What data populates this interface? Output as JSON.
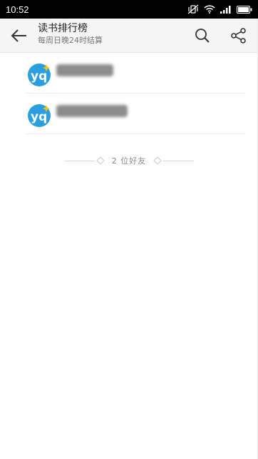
{
  "status_bar": {
    "time": "10:52",
    "icons": [
      "vibrate-off-icon",
      "wifi-icon",
      "signal-icon",
      "battery-icon"
    ]
  },
  "header": {
    "title": "读书排行榜",
    "subtitle": "每周日晚24时结算",
    "back_icon": "back-arrow-icon",
    "search_icon": "search-icon",
    "share_icon": "share-icon"
  },
  "friends": [
    {
      "avatar_icon": "yq-logo-avatar",
      "name": ""
    },
    {
      "avatar_icon": "yq-logo-avatar",
      "name": ""
    }
  ],
  "footer": {
    "count_text": "2 位好友"
  },
  "colors": {
    "avatar_blue": "#2a9fe0",
    "avatar_yellow": "#f2c21a"
  }
}
